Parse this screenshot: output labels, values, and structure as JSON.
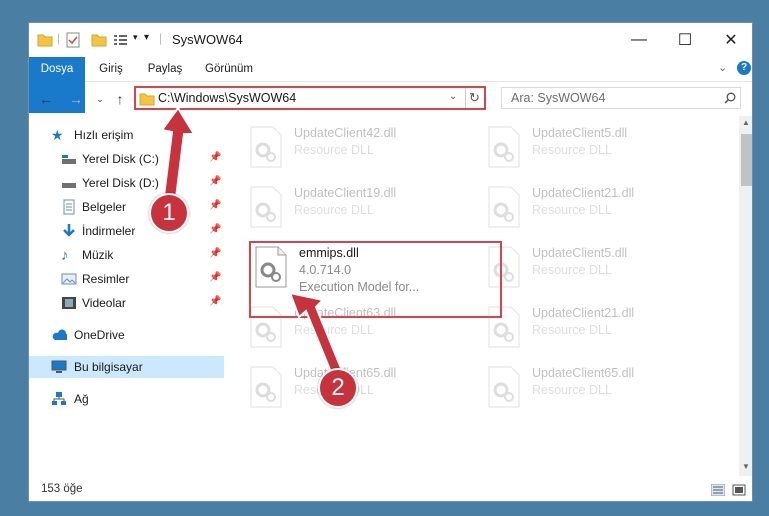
{
  "window": {
    "title": "SysWOW64"
  },
  "ribbon": {
    "tabs": [
      "Dosya",
      "Giriş",
      "Paylaş",
      "Görünüm"
    ]
  },
  "nav": {
    "address": "C:\\Windows\\SysWOW64",
    "search_placeholder": "Ara: SysWOW64"
  },
  "sidebar": {
    "quick_access": "Hızlı erişim",
    "items": [
      {
        "label": "Yerel Disk (C:)",
        "icon": "drive-icon"
      },
      {
        "label": "Yerel Disk (D:)",
        "icon": "drive-icon"
      },
      {
        "label": "Belgeler",
        "icon": "documents-icon"
      },
      {
        "label": "İndirmeler",
        "icon": "downloads-icon"
      },
      {
        "label": "Müzik",
        "icon": "music-icon"
      },
      {
        "label": "Resimler",
        "icon": "pictures-icon"
      },
      {
        "label": "Videolar",
        "icon": "videos-icon"
      }
    ],
    "onedrive": "OneDrive",
    "this_pc": "Bu bilgisayar",
    "network": "Ağ"
  },
  "files": [
    {
      "name": "UpdateClient42.dll",
      "desc": "Resource DLL"
    },
    {
      "name": "UpdateClient5.dll",
      "desc": "Resource DLL"
    },
    {
      "name": "UpdateClient19.dll",
      "desc": "Resource DLL"
    },
    {
      "name": "UpdateClient21.dll",
      "desc": "Resource DLL"
    },
    {
      "name": "emmips.dll",
      "version": "4.0.714.0",
      "desc": "Execution Model for..."
    },
    {
      "name": "UpdateClient5.dll",
      "desc": "Resource DLL"
    },
    {
      "name": "UpdateClient63.dll",
      "desc": "Resource DLL"
    },
    {
      "name": "UpdateClient21.dll",
      "desc": "Resource DLL"
    },
    {
      "name": "UpdateClient65.dll",
      "desc": "Resource DLL"
    },
    {
      "name": "UpdateClient65.dll",
      "desc": "Resource DLL"
    }
  ],
  "status": {
    "count": "153 öğe"
  },
  "annotations": [
    "1",
    "2"
  ],
  "colors": {
    "accent": "#1979ca",
    "highlight": "#d9434b",
    "selected": "#cce8ff"
  }
}
